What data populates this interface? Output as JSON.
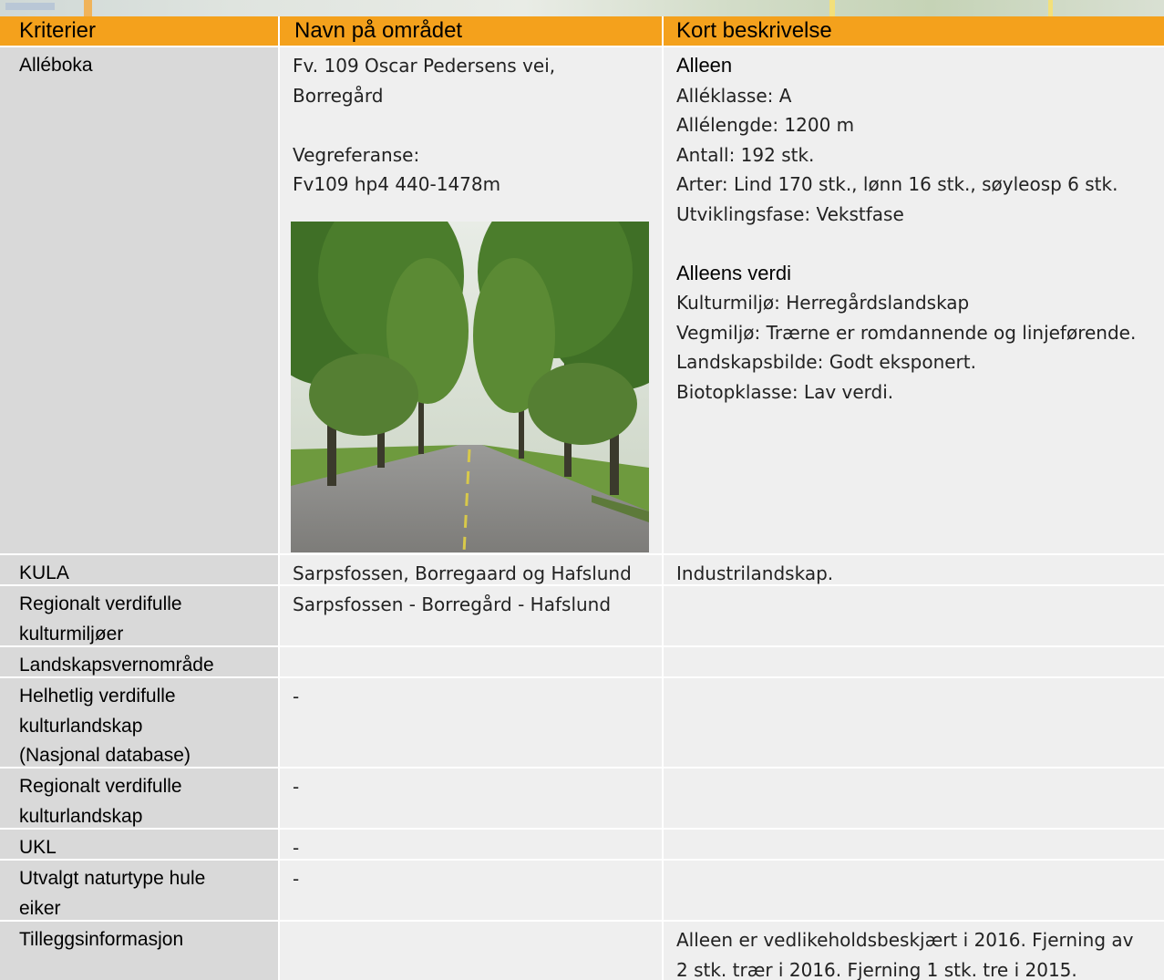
{
  "header": {
    "col1": "Kriterier",
    "col2": "Navn på området",
    "col3": "Kort beskrivelse"
  },
  "rows": {
    "alleboka": {
      "label": "Alléboka",
      "name_lines": [
        "Fv. 109 Oscar Pedersens vei,",
        "Borregård"
      ],
      "vegref_label": "Vegreferanse:",
      "vegref_value": "Fv109 hp4 440-1478m",
      "alleen_heading": "Alleen",
      "alleen_lines": [
        "Alléklasse: A",
        "Allélengde: 1200 m",
        "Antall: 192 stk.",
        "Arter: Lind 170 stk., lønn 16 stk., søyleosp 6 stk.",
        "Utviklingsfase: Vekstfase"
      ],
      "verdi_heading": "Alleens verdi",
      "verdi_lines": [
        "Kulturmiljø: Herregårdslandskap",
        "Vegmiljø: Trærne er romdannende og linjeførende.",
        "Landskapsbilde: Godt eksponert.",
        "Biotopklasse: Lav verdi."
      ]
    },
    "kula": {
      "label": "KULA",
      "name": "Sarpsfossen, Borregaard og Hafslund",
      "desc": "Industrilandskap."
    },
    "regional_kulturmiljo": {
      "label_lines": [
        "Regionalt verdifulle",
        "kulturmiljøer"
      ],
      "name": "Sarpsfossen - Borregård - Hafslund",
      "desc": ""
    },
    "landskapsvern": {
      "label": "Landskapsvernområde",
      "name": "",
      "desc": ""
    },
    "helhetlig": {
      "label_lines": [
        "Helhetlig verdifulle",
        "kulturlandskap",
        "(Nasjonal database)"
      ],
      "name": "-",
      "desc": ""
    },
    "regional_kulturlandskap": {
      "label_lines": [
        "Regionalt verdifulle",
        "kulturlandskap"
      ],
      "name": "-",
      "desc": ""
    },
    "ukl": {
      "label": "UKL",
      "name": "-",
      "desc": ""
    },
    "hule_eiker": {
      "label_lines": [
        "Utvalgt naturtype hule",
        "eiker"
      ],
      "name": "-",
      "desc": ""
    },
    "tillegg": {
      "label": "Tilleggsinformasjon",
      "name": "",
      "desc_lines": [
        "Alleen er vedlikeholdsbeskjært i 2016. Fjerning av",
        "2 stk. trær i 2016. Fjerning 1 stk. tre i 2015."
      ]
    }
  }
}
